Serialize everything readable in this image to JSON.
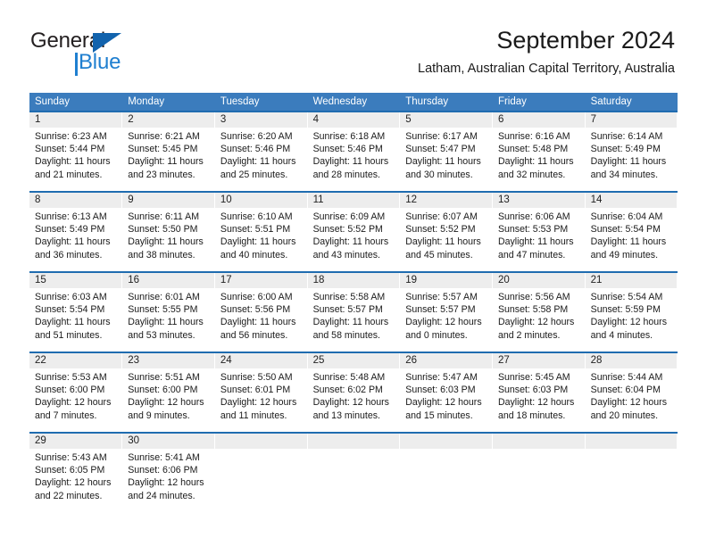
{
  "brand": {
    "name_part1": "General",
    "name_part2": "Blue",
    "triangle_icon": "triangle-icon"
  },
  "header": {
    "title": "September 2024",
    "subtitle": "Latham, Australian Capital Territory, Australia"
  },
  "colors": {
    "header_blue": "#3b7cbd",
    "row_divider_blue": "#1f6cb0",
    "daynum_band": "#ededed",
    "brand_blue": "#1f7fd0",
    "text": "#1a1a1a"
  },
  "calendar": {
    "weekdays": [
      "Sunday",
      "Monday",
      "Tuesday",
      "Wednesday",
      "Thursday",
      "Friday",
      "Saturday"
    ],
    "weeks": [
      [
        {
          "day": "1",
          "sunrise": "Sunrise: 6:23 AM",
          "sunset": "Sunset: 5:44 PM",
          "daylight": "Daylight: 11 hours and 21 minutes."
        },
        {
          "day": "2",
          "sunrise": "Sunrise: 6:21 AM",
          "sunset": "Sunset: 5:45 PM",
          "daylight": "Daylight: 11 hours and 23 minutes."
        },
        {
          "day": "3",
          "sunrise": "Sunrise: 6:20 AM",
          "sunset": "Sunset: 5:46 PM",
          "daylight": "Daylight: 11 hours and 25 minutes."
        },
        {
          "day": "4",
          "sunrise": "Sunrise: 6:18 AM",
          "sunset": "Sunset: 5:46 PM",
          "daylight": "Daylight: 11 hours and 28 minutes."
        },
        {
          "day": "5",
          "sunrise": "Sunrise: 6:17 AM",
          "sunset": "Sunset: 5:47 PM",
          "daylight": "Daylight: 11 hours and 30 minutes."
        },
        {
          "day": "6",
          "sunrise": "Sunrise: 6:16 AM",
          "sunset": "Sunset: 5:48 PM",
          "daylight": "Daylight: 11 hours and 32 minutes."
        },
        {
          "day": "7",
          "sunrise": "Sunrise: 6:14 AM",
          "sunset": "Sunset: 5:49 PM",
          "daylight": "Daylight: 11 hours and 34 minutes."
        }
      ],
      [
        {
          "day": "8",
          "sunrise": "Sunrise: 6:13 AM",
          "sunset": "Sunset: 5:49 PM",
          "daylight": "Daylight: 11 hours and 36 minutes."
        },
        {
          "day": "9",
          "sunrise": "Sunrise: 6:11 AM",
          "sunset": "Sunset: 5:50 PM",
          "daylight": "Daylight: 11 hours and 38 minutes."
        },
        {
          "day": "10",
          "sunrise": "Sunrise: 6:10 AM",
          "sunset": "Sunset: 5:51 PM",
          "daylight": "Daylight: 11 hours and 40 minutes."
        },
        {
          "day": "11",
          "sunrise": "Sunrise: 6:09 AM",
          "sunset": "Sunset: 5:52 PM",
          "daylight": "Daylight: 11 hours and 43 minutes."
        },
        {
          "day": "12",
          "sunrise": "Sunrise: 6:07 AM",
          "sunset": "Sunset: 5:52 PM",
          "daylight": "Daylight: 11 hours and 45 minutes."
        },
        {
          "day": "13",
          "sunrise": "Sunrise: 6:06 AM",
          "sunset": "Sunset: 5:53 PM",
          "daylight": "Daylight: 11 hours and 47 minutes."
        },
        {
          "day": "14",
          "sunrise": "Sunrise: 6:04 AM",
          "sunset": "Sunset: 5:54 PM",
          "daylight": "Daylight: 11 hours and 49 minutes."
        }
      ],
      [
        {
          "day": "15",
          "sunrise": "Sunrise: 6:03 AM",
          "sunset": "Sunset: 5:54 PM",
          "daylight": "Daylight: 11 hours and 51 minutes."
        },
        {
          "day": "16",
          "sunrise": "Sunrise: 6:01 AM",
          "sunset": "Sunset: 5:55 PM",
          "daylight": "Daylight: 11 hours and 53 minutes."
        },
        {
          "day": "17",
          "sunrise": "Sunrise: 6:00 AM",
          "sunset": "Sunset: 5:56 PM",
          "daylight": "Daylight: 11 hours and 56 minutes."
        },
        {
          "day": "18",
          "sunrise": "Sunrise: 5:58 AM",
          "sunset": "Sunset: 5:57 PM",
          "daylight": "Daylight: 11 hours and 58 minutes."
        },
        {
          "day": "19",
          "sunrise": "Sunrise: 5:57 AM",
          "sunset": "Sunset: 5:57 PM",
          "daylight": "Daylight: 12 hours and 0 minutes."
        },
        {
          "day": "20",
          "sunrise": "Sunrise: 5:56 AM",
          "sunset": "Sunset: 5:58 PM",
          "daylight": "Daylight: 12 hours and 2 minutes."
        },
        {
          "day": "21",
          "sunrise": "Sunrise: 5:54 AM",
          "sunset": "Sunset: 5:59 PM",
          "daylight": "Daylight: 12 hours and 4 minutes."
        }
      ],
      [
        {
          "day": "22",
          "sunrise": "Sunrise: 5:53 AM",
          "sunset": "Sunset: 6:00 PM",
          "daylight": "Daylight: 12 hours and 7 minutes."
        },
        {
          "day": "23",
          "sunrise": "Sunrise: 5:51 AM",
          "sunset": "Sunset: 6:00 PM",
          "daylight": "Daylight: 12 hours and 9 minutes."
        },
        {
          "day": "24",
          "sunrise": "Sunrise: 5:50 AM",
          "sunset": "Sunset: 6:01 PM",
          "daylight": "Daylight: 12 hours and 11 minutes."
        },
        {
          "day": "25",
          "sunrise": "Sunrise: 5:48 AM",
          "sunset": "Sunset: 6:02 PM",
          "daylight": "Daylight: 12 hours and 13 minutes."
        },
        {
          "day": "26",
          "sunrise": "Sunrise: 5:47 AM",
          "sunset": "Sunset: 6:03 PM",
          "daylight": "Daylight: 12 hours and 15 minutes."
        },
        {
          "day": "27",
          "sunrise": "Sunrise: 5:45 AM",
          "sunset": "Sunset: 6:03 PM",
          "daylight": "Daylight: 12 hours and 18 minutes."
        },
        {
          "day": "28",
          "sunrise": "Sunrise: 5:44 AM",
          "sunset": "Sunset: 6:04 PM",
          "daylight": "Daylight: 12 hours and 20 minutes."
        }
      ],
      [
        {
          "day": "29",
          "sunrise": "Sunrise: 5:43 AM",
          "sunset": "Sunset: 6:05 PM",
          "daylight": "Daylight: 12 hours and 22 minutes."
        },
        {
          "day": "30",
          "sunrise": "Sunrise: 5:41 AM",
          "sunset": "Sunset: 6:06 PM",
          "daylight": "Daylight: 12 hours and 24 minutes."
        },
        {
          "day": "",
          "sunrise": "",
          "sunset": "",
          "daylight": ""
        },
        {
          "day": "",
          "sunrise": "",
          "sunset": "",
          "daylight": ""
        },
        {
          "day": "",
          "sunrise": "",
          "sunset": "",
          "daylight": ""
        },
        {
          "day": "",
          "sunrise": "",
          "sunset": "",
          "daylight": ""
        },
        {
          "day": "",
          "sunrise": "",
          "sunset": "",
          "daylight": ""
        }
      ]
    ]
  }
}
